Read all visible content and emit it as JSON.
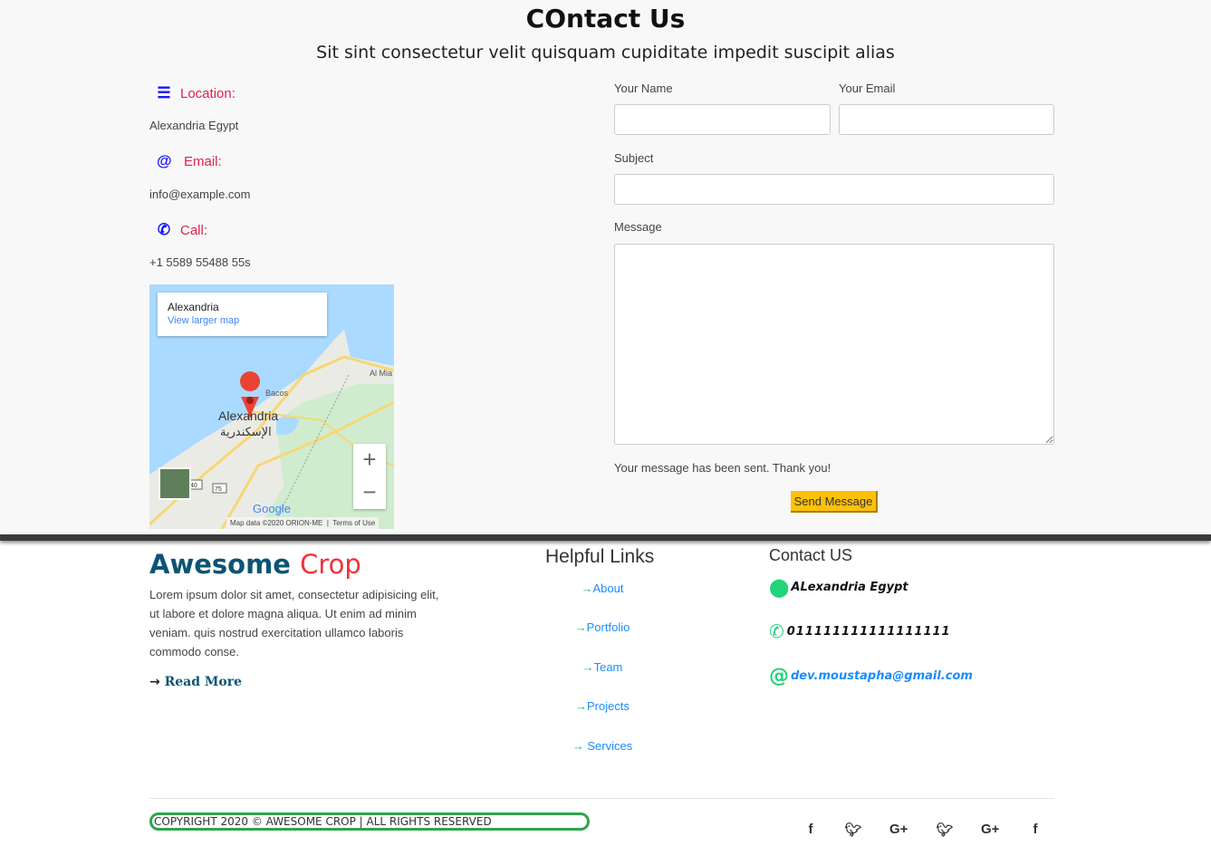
{
  "contact": {
    "title": "COntact Us",
    "subtitle": "Sit sint consectetur velit quisquam cupiditate impedit suscipit alias",
    "location_label": "Location:",
    "location": "Alexandria Egypt",
    "email_label": "Email:",
    "email": "info@example.com",
    "call_label": "Call:",
    "phone": "+1 5589 55488 55s",
    "map": {
      "place": "Alexandria",
      "link": "View larger map",
      "city_label": "Alexandria",
      "city_label_ar": "الإسكندرية",
      "bacos": "Bacos",
      "al_mia": "Al Mia",
      "road_40": "40",
      "road_75": "75",
      "google": "Google",
      "attribution": "Map data ©2020 ORION-ME",
      "terms": "Terms of Use"
    },
    "form": {
      "name_label": "Your Name",
      "email_label": "Your Email",
      "subject_label": "Subject",
      "message_label": "Message",
      "sent_text": "Your message has been sent. Thank you!",
      "send_label": "Send Message"
    }
  },
  "footer": {
    "brand1": "Awesome",
    "brand2": "Crop",
    "about": "Lorem ipsum dolor sit amet, consectetur adipisicing elit, ut labore et dolore magna aliqua. Ut enim ad minim veniam. quis nostrud exercitation ullamco laboris commodo conse.",
    "read_more": "Read More",
    "links_title": "Helpful Links",
    "links": [
      "About",
      "Portfolio",
      "Team",
      "Projects",
      "Services"
    ],
    "contact_title": "Contact US",
    "address": "ALexandria Egypt",
    "phone": "011111111111111111",
    "email": "dev.moustapha@gmail.com",
    "copyright": "COPYRIGHT 2020 © AWESOME CROP | ALL RIGHTS RESERVED",
    "social": [
      "facebook-icon",
      "twitter-icon",
      "google-plus-icon",
      "twitter-icon",
      "google-plus-icon",
      "facebook-icon"
    ]
  },
  "colors": {
    "accent_red": "#e2204a",
    "icon_blue": "#1515ff",
    "send_button": "#ffc107",
    "brand_blue": "#0b5474",
    "link_blue": "#1a8cff",
    "green": "#22d47a"
  }
}
